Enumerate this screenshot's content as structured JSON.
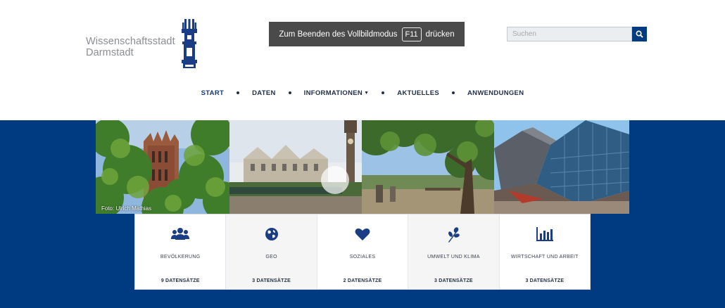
{
  "logo": {
    "line1": "Wissenschaftsstadt",
    "line2": "Darmstadt"
  },
  "fullscreen_banner": {
    "prefix": "Zum Beenden des Vollbildmodus",
    "key": "F11",
    "suffix": "drücken"
  },
  "search": {
    "placeholder": "Suchen",
    "icon": "search-icon"
  },
  "nav": [
    {
      "label": "START"
    },
    {
      "label": "DATEN"
    },
    {
      "label": "INFORMATIONEN",
      "icon": "caret-down-icon"
    },
    {
      "label": "AKTUELLES"
    },
    {
      "label": "ANWENDUNGEN"
    }
  ],
  "photos": {
    "credit": "Foto: Ulrich Mathias"
  },
  "categories": [
    {
      "title": "BEVÖLKERUNG",
      "count": "9 DATENSÄTZE",
      "icon": "users-icon"
    },
    {
      "title": "GEO",
      "count": "3 DATENSÄTZE",
      "icon": "globe-icon"
    },
    {
      "title": "SOZIALES",
      "count": "2 DATENSÄTZE",
      "icon": "heart-icon"
    },
    {
      "title": "UMWELT UND KLIMA",
      "count": "3 DATENSÄTZE",
      "icon": "leaf-icon"
    },
    {
      "title": "WIRTSCHAFT UND ARBEIT",
      "count": "3 DATENSÄTZE",
      "icon": "bar-chart-icon"
    }
  ],
  "colors": {
    "brand_blue": "#003a80",
    "nav_text": "#1f2f47",
    "banner_bg": "#4a4a4a"
  }
}
